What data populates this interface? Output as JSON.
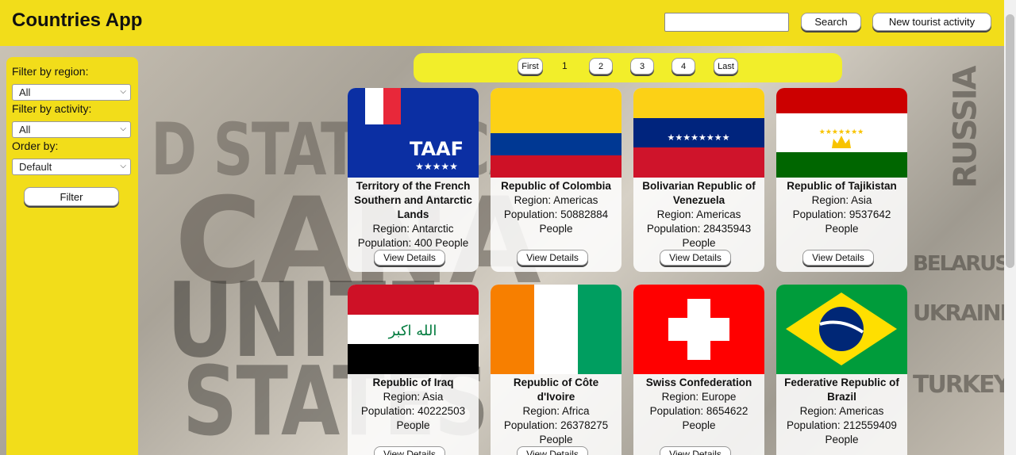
{
  "header": {
    "title": "Countries App",
    "search_placeholder": "",
    "search_label": "Search",
    "new_activity_label": "New tourist activity"
  },
  "sidebar": {
    "region_label": "Filter by region:",
    "region_value": "All",
    "activity_label": "Filter by activity:",
    "activity_value": "All",
    "order_label": "Order by:",
    "order_value": "Default",
    "filter_label": "Filter"
  },
  "pagination": {
    "first": "First",
    "current": "1",
    "pages": [
      "2",
      "3",
      "4"
    ],
    "last": "Last"
  },
  "card_common": {
    "details_label": "View Details"
  },
  "cards": [
    {
      "name": "Territory of the French Southern and Antarctic Lands",
      "region": "Region: Antarctic",
      "population": "Population: 400 People",
      "flag": "flag-icon"
    },
    {
      "name": "Republic of Colombia",
      "region": "Region: Americas",
      "population": "Population: 50882884 People",
      "flag": "flag-icon"
    },
    {
      "name": "Bolivarian Republic of Venezuela",
      "region": "Region: Americas",
      "population": "Population: 28435943 People",
      "flag": "flag-icon"
    },
    {
      "name": "Republic of Tajikistan",
      "region": "Region: Asia",
      "population": "Population: 9537642 People",
      "flag": "flag-icon"
    },
    {
      "name": "Republic of Iraq",
      "region": "Region: Asia",
      "population": "Population: 40222503 People",
      "flag": "flag-icon"
    },
    {
      "name": "Republic of Côte d'Ivoire",
      "region": "Region: Africa",
      "population": "Population: 26378275 People",
      "flag": "flag-icon"
    },
    {
      "name": "Swiss Confederation",
      "region": "Region: Europe",
      "population": "Population: 8654622 People",
      "flag": "flag-icon"
    },
    {
      "name": "Federative Republic of Brazil",
      "region": "Region: Americas",
      "population": "Population: 212559409 People",
      "flag": "flag-icon"
    }
  ],
  "background_words": {
    "w1": "D STATES CA",
    "w2": "CANA",
    "w3": "UNITE",
    "w4": "STATES",
    "w5": "RUSSIA",
    "w6": "UKRAINE",
    "w7": "TURKEY",
    "w8": "BELARUS"
  },
  "colors": {
    "accent": "#f2dd1a",
    "pager_bg": "#f2ee2a"
  }
}
